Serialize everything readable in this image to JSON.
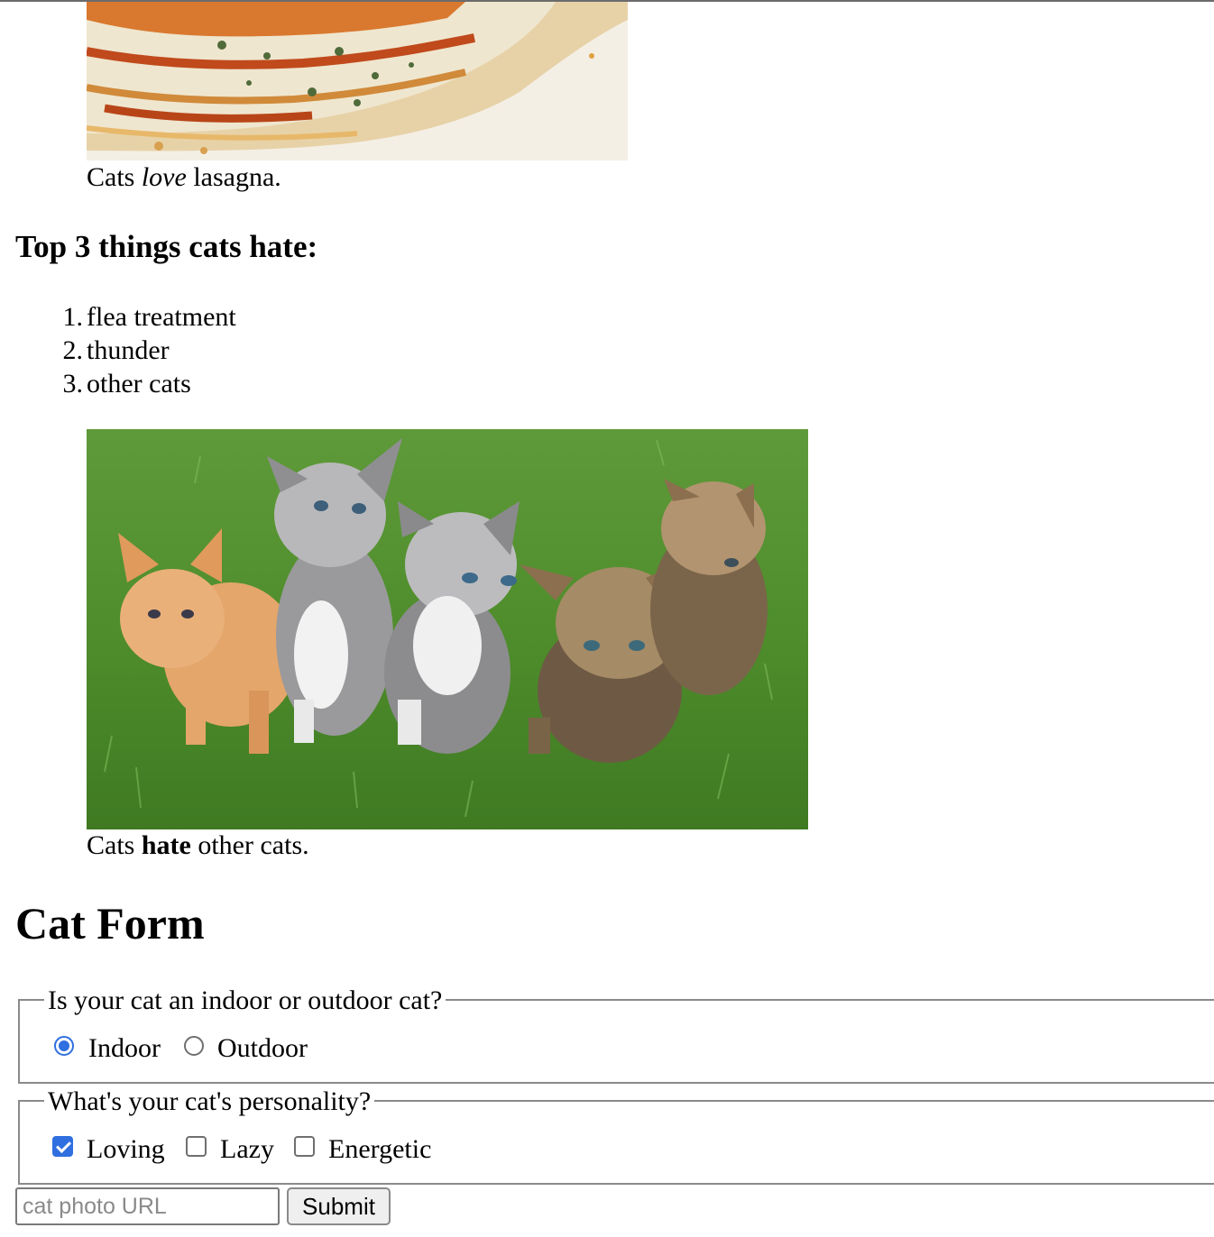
{
  "lasagna_figure": {
    "caption_before": "Cats ",
    "caption_em": "love",
    "caption_after": " lasagna."
  },
  "hates_section": {
    "heading": "Top 3 things cats hate:",
    "items": [
      {
        "num": "1.",
        "text": "flea treatment"
      },
      {
        "num": "2.",
        "text": "thunder"
      },
      {
        "num": "3.",
        "text": "other cats"
      }
    ]
  },
  "kittens_figure": {
    "caption_before": "Cats ",
    "caption_strong": "hate",
    "caption_after": " other cats."
  },
  "form": {
    "heading": "Cat Form",
    "indoor_outdoor": {
      "legend": "Is your cat an indoor or outdoor cat?",
      "options": [
        {
          "label": "Indoor",
          "checked": true
        },
        {
          "label": "Outdoor",
          "checked": false
        }
      ]
    },
    "personality": {
      "legend": "What's your cat's personality?",
      "options": [
        {
          "label": "Loving",
          "checked": true
        },
        {
          "label": "Lazy",
          "checked": false
        },
        {
          "label": "Energetic",
          "checked": false
        }
      ]
    },
    "url_input": {
      "placeholder": "cat photo URL",
      "value": ""
    },
    "submit_label": "Submit"
  },
  "colors": {
    "accent": "#2f6fe0",
    "border": "#8a8a8a"
  }
}
